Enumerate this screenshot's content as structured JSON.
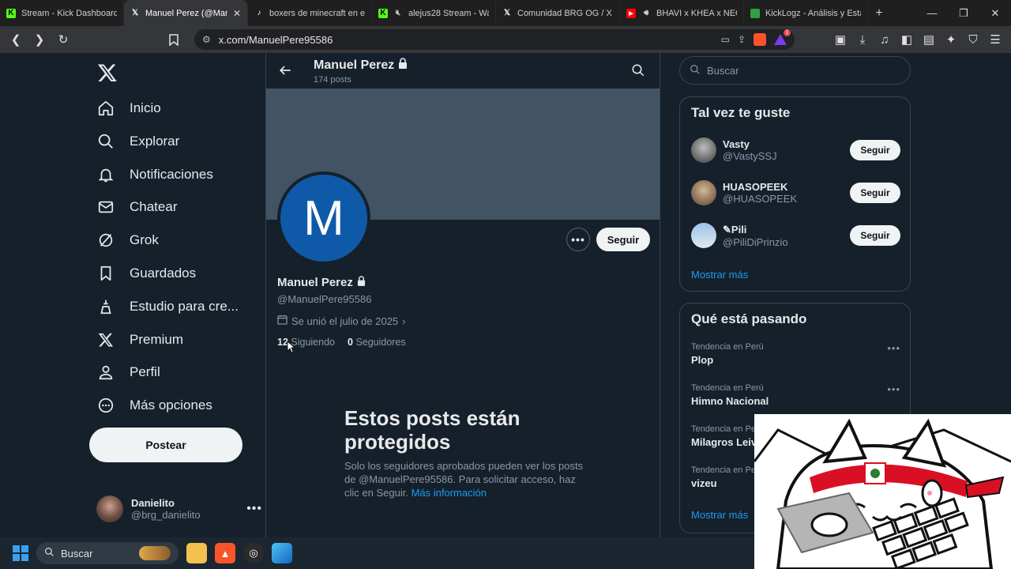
{
  "browser": {
    "tabs": [
      {
        "title": "Stream - Kick Dashboard",
        "icon": "kick-icon",
        "color": "#53fc18",
        "active": false
      },
      {
        "title": "Manuel Perez (@Manu",
        "icon": "x-icon",
        "color": "#ffffff",
        "active": true
      },
      {
        "title": "boxers de minecraft en el",
        "icon": "tiktok-icon",
        "color": "#ffffff",
        "active": false
      },
      {
        "title": "alejus28 Stream - Wat",
        "icon": "kick-icon",
        "color": "#53fc18",
        "active": false
      },
      {
        "title": "Comunidad BRG OG / X",
        "icon": "x-icon",
        "color": "#ffffff",
        "active": false
      },
      {
        "title": "BHAVI x KHEA x NEO P",
        "icon": "youtube-icon",
        "color": "#ff0000",
        "active": false
      },
      {
        "title": "KickLogz - Análisis y Estad",
        "icon": "spreadsheet-icon",
        "color": "#2ea043",
        "active": false
      }
    ],
    "url": "x.com/ManuelPere95586",
    "notification_count": "1"
  },
  "nav": {
    "items": [
      {
        "label": "Inicio",
        "icon": "home-icon"
      },
      {
        "label": "Explorar",
        "icon": "search-icon"
      },
      {
        "label": "Notificaciones",
        "icon": "bell-icon"
      },
      {
        "label": "Chatear",
        "icon": "mail-icon"
      },
      {
        "label": "Grok",
        "icon": "grok-icon"
      },
      {
        "label": "Guardados",
        "icon": "bookmark-icon"
      },
      {
        "label": "Estudio para cre...",
        "icon": "studio-icon"
      },
      {
        "label": "Premium",
        "icon": "x-icon"
      },
      {
        "label": "Perfil",
        "icon": "person-icon"
      },
      {
        "label": "Más opciones",
        "icon": "more-circle-icon"
      }
    ],
    "post_label": "Postear",
    "account": {
      "name": "Danielito",
      "handle": "@brg_danielito"
    }
  },
  "profile": {
    "header_name": "Manuel Perez",
    "post_count": "174 posts",
    "avatar_letter": "M",
    "name": "Manuel Perez",
    "handle": "@ManuelPere95586",
    "joined": "Se unió el julio de 2025",
    "following_count": "12",
    "following_label": "Siguiendo",
    "followers_count": "0",
    "followers_label": "Seguidores",
    "follow_label": "Seguir",
    "protected_title": "Estos posts están protegidos",
    "protected_body": "Solo los seguidores aprobados pueden ver los posts de @ManuelPere95586. Para solicitar acceso, haz clic en Seguir.",
    "protected_link": "Más información"
  },
  "right": {
    "search_placeholder": "Buscar",
    "suggestions_title": "Tal vez te guste",
    "suggestions": [
      {
        "name": "Vasty",
        "handle": "@VastySSJ",
        "button": "Seguir"
      },
      {
        "name": "HUASOPEEK",
        "handle": "@HUASOPEEK",
        "button": "Seguir"
      },
      {
        "name": "Pili",
        "handle": "@PiliDiPrinzio",
        "button": "Seguir"
      }
    ],
    "suggestions_more": "Mostrar más",
    "trends_title": "Qué está pasando",
    "trends": [
      {
        "context": "Tendencia en Perú",
        "title": "Plop"
      },
      {
        "context": "Tendencia en Perú",
        "title": "Himno Nacional"
      },
      {
        "context": "Tendencia en Pe",
        "title": "Milagros Leiva"
      },
      {
        "context": "Tendencia en Pe",
        "title": "vizeu"
      }
    ],
    "trends_more": "Mostrar más"
  },
  "taskbar": {
    "search_label": "Buscar"
  }
}
